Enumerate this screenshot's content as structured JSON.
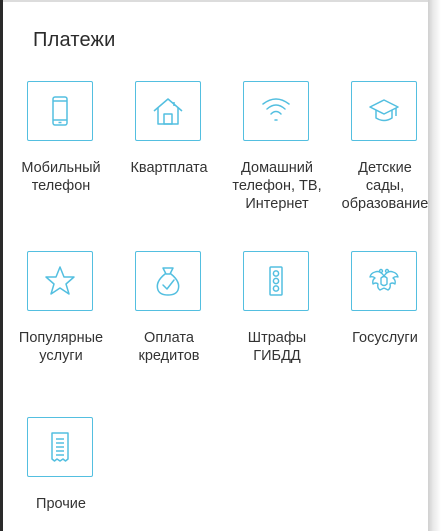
{
  "header": {
    "title": "Платежи"
  },
  "tiles": [
    {
      "label_1": "Мобильный",
      "label_2": "телефон",
      "label_3": "",
      "icon": "mobile-phone-icon"
    },
    {
      "label_1": "Квартплата",
      "label_2": "",
      "label_3": "",
      "icon": "house-icon"
    },
    {
      "label_1": "Домашний",
      "label_2": "телефон, ТВ,",
      "label_3": "Интернет",
      "icon": "wifi-icon"
    },
    {
      "label_1": "Детские",
      "label_2": "сады,",
      "label_3": "образование",
      "icon": "graduation-cap-icon"
    },
    {
      "label_1": "Популярные",
      "label_2": "услуги",
      "label_3": "",
      "icon": "star-icon"
    },
    {
      "label_1": "Оплата",
      "label_2": "кредитов",
      "label_3": "",
      "icon": "money-bag-icon"
    },
    {
      "label_1": "Штрафы",
      "label_2": "ГИБДД",
      "label_3": "",
      "icon": "traffic-light-icon"
    },
    {
      "label_1": "Госуслуги",
      "label_2": "",
      "label_3": "",
      "icon": "eagle-emblem-icon"
    },
    {
      "label_1": "Прочие",
      "label_2": "",
      "label_3": "",
      "icon": "receipt-icon"
    }
  ],
  "colors": {
    "accent": "#53bfe0",
    "text": "#333333",
    "title": "#2b2b2b"
  }
}
